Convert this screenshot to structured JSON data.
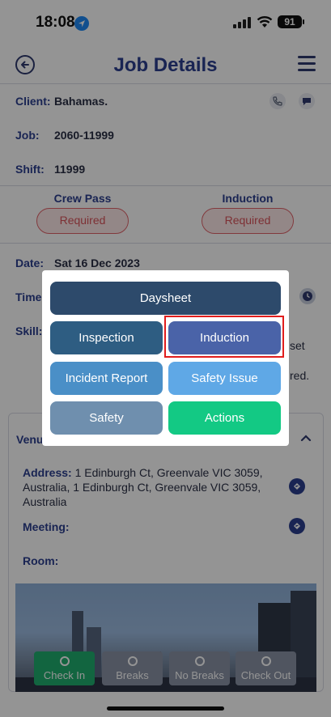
{
  "status": {
    "time": "18:08",
    "battery": "91"
  },
  "header": {
    "title": "Job Details"
  },
  "info": {
    "client_label": "Client:",
    "client_value": "Bahamas.",
    "job_label": "Job:",
    "job_value": "2060-11999",
    "shift_label": "Shift:",
    "shift_value": "11999"
  },
  "passes": [
    {
      "title": "Crew Pass",
      "status": "Required"
    },
    {
      "title": "Induction",
      "status": "Required"
    }
  ],
  "details": {
    "date_label": "Date:",
    "date_value": "Sat 16 Dec 2023",
    "time_label": "Time",
    "skill_label": "Skill:",
    "skill_trailing_1": "set",
    "skill_trailing_2": "red."
  },
  "venue": {
    "label": "Venu",
    "address_label": "Address:",
    "address_value": "1 Edinburgh Ct, Greenvale VIC 3059, Australia, 1 Edinburgh Ct, Greenvale VIC 3059, Australia",
    "meeting_label": "Meeting:",
    "room_label": "Room:"
  },
  "actions": [
    "Check In",
    "Breaks",
    "No Breaks",
    "Check Out"
  ],
  "modal": {
    "buttons": {
      "daysheet": "Daysheet",
      "inspection": "Inspection",
      "induction": "Induction",
      "incident_report": "Incident Report",
      "safety_issue": "Safety Issue",
      "safety": "Safety",
      "actions": "Actions"
    },
    "colors": {
      "daysheet": "#2d4a6b",
      "inspection": "#2e5d82",
      "induction": "#4a63a8",
      "incident_report": "#4a8fc7",
      "safety_issue": "#5fa8e6",
      "safety": "#6f8fae",
      "actions": "#13c984"
    }
  },
  "icons": [
    "back-arrow-icon",
    "hamburger-menu-icon",
    "phone-icon",
    "chat-icon",
    "clock-icon",
    "chevron-up-icon",
    "directions-icon",
    "location-pin-icon"
  ]
}
